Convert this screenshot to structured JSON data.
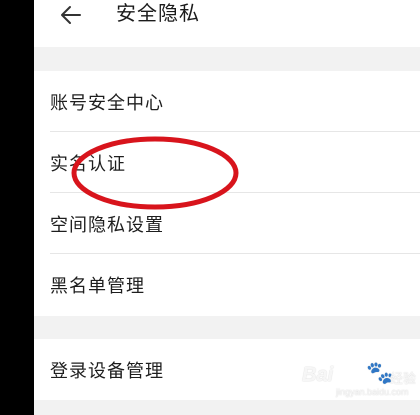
{
  "header": {
    "title": "安全隐私",
    "back_icon": "arrow-left-icon"
  },
  "settings": {
    "group1": [
      {
        "label": "账号安全中心"
      },
      {
        "label": "实名认证"
      },
      {
        "label": "空间隐私设置"
      },
      {
        "label": "黑名单管理"
      }
    ],
    "group2": [
      {
        "label": "登录设备管理"
      }
    ]
  },
  "annotation": {
    "shape": "ellipse",
    "color": "#d8141c",
    "target": "实名认证"
  },
  "watermark": {
    "logo": "Bai",
    "logo_icon": "paw-icon",
    "suffix": "经验",
    "url": "jingyan.baidu.com"
  },
  "colors": {
    "background": "#f2f2f2",
    "card": "#ffffff",
    "text": "#1e1e1e",
    "divider": "#e6e6e6",
    "annotation_red": "#d8141c"
  }
}
